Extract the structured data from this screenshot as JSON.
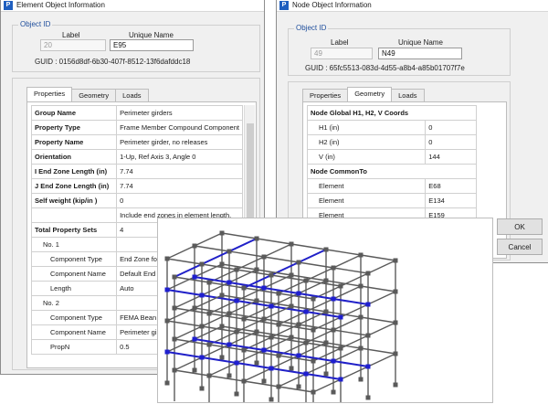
{
  "element_window": {
    "title": "Element Object Information",
    "object_id": {
      "group_title": "Object ID",
      "label_header": "Label",
      "name_header": "Unique Name",
      "label_value": "20",
      "name_value": "E95",
      "guid": "GUID : 0156d8df-6b30-407f-8512-13f6dafddc18"
    },
    "tabs": [
      "Properties",
      "Geometry",
      "Loads"
    ],
    "active_tab": "Properties",
    "rows": [
      {
        "name": "Group Name",
        "value": "Perimeter girders",
        "bold": true
      },
      {
        "name": "Property Type",
        "value": "Frame Member Compound Component",
        "bold": true
      },
      {
        "name": "Property Name",
        "value": "Perimeter girder, no releases",
        "bold": true
      },
      {
        "name": "Orientation",
        "value": "1-Up, Ref Axis 3, Angle 0",
        "bold": true
      },
      {
        "name": "I End Zone Length (in)",
        "value": "7.74",
        "bold": true
      },
      {
        "name": "J End Zone Length (in)",
        "value": "7.74",
        "bold": true
      },
      {
        "name": "Self weight (kip/in )",
        "value": "0",
        "bold": true
      },
      {
        "name": "",
        "value": "Include end zones in element length.",
        "bold": false
      },
      {
        "name": "Total Property Sets",
        "value": "4",
        "bold": true
      },
      {
        "name": "No. 1",
        "value": "",
        "bold": false,
        "indent": 1
      },
      {
        "name": "Component Type",
        "value": "End Zone fo",
        "bold": false,
        "indent": 2
      },
      {
        "name": "Component Name",
        "value": "Default End",
        "bold": false,
        "indent": 2
      },
      {
        "name": "Length",
        "value": "Auto",
        "bold": false,
        "indent": 2
      },
      {
        "name": "No. 2",
        "value": "",
        "bold": false,
        "indent": 1
      },
      {
        "name": "Component Type",
        "value": "FEMA Bean",
        "bold": false,
        "indent": 2
      },
      {
        "name": "Component Name",
        "value": "Perimeter gi",
        "bold": false,
        "indent": 2
      },
      {
        "name": "PropN",
        "value": "0.5",
        "bold": false,
        "indent": 2
      }
    ]
  },
  "node_window": {
    "title": "Node Object Information",
    "object_id": {
      "group_title": "Object ID",
      "label_header": "Label",
      "name_header": "Unique Name",
      "label_value": "49",
      "name_value": "N49",
      "guid": "GUID : 65fc5513-083d-4d55-a8b4-a85b01707f7e"
    },
    "tabs": [
      "Properties",
      "Geometry",
      "Loads"
    ],
    "active_tab": "Geometry",
    "rows": [
      {
        "name": "Node Global H1, H2, V Coords",
        "value": "",
        "header": true
      },
      {
        "name": "H1 (in)",
        "value": "0"
      },
      {
        "name": "H2 (in)",
        "value": "0"
      },
      {
        "name": "V (in)",
        "value": "144"
      },
      {
        "name": "Node CommonTo",
        "value": "",
        "header": true
      },
      {
        "name": "Element",
        "value": "E68"
      },
      {
        "name": "Element",
        "value": "E134"
      },
      {
        "name": "Element",
        "value": "E159"
      }
    ],
    "ok_label": "OK",
    "cancel_label": "Cancel"
  },
  "model_view": {
    "frame_color": "#5a5a5a",
    "highlight_color": "#2020c8",
    "node_color": "#5a5a5a",
    "highlight_node_color": "#1f1fd0"
  }
}
